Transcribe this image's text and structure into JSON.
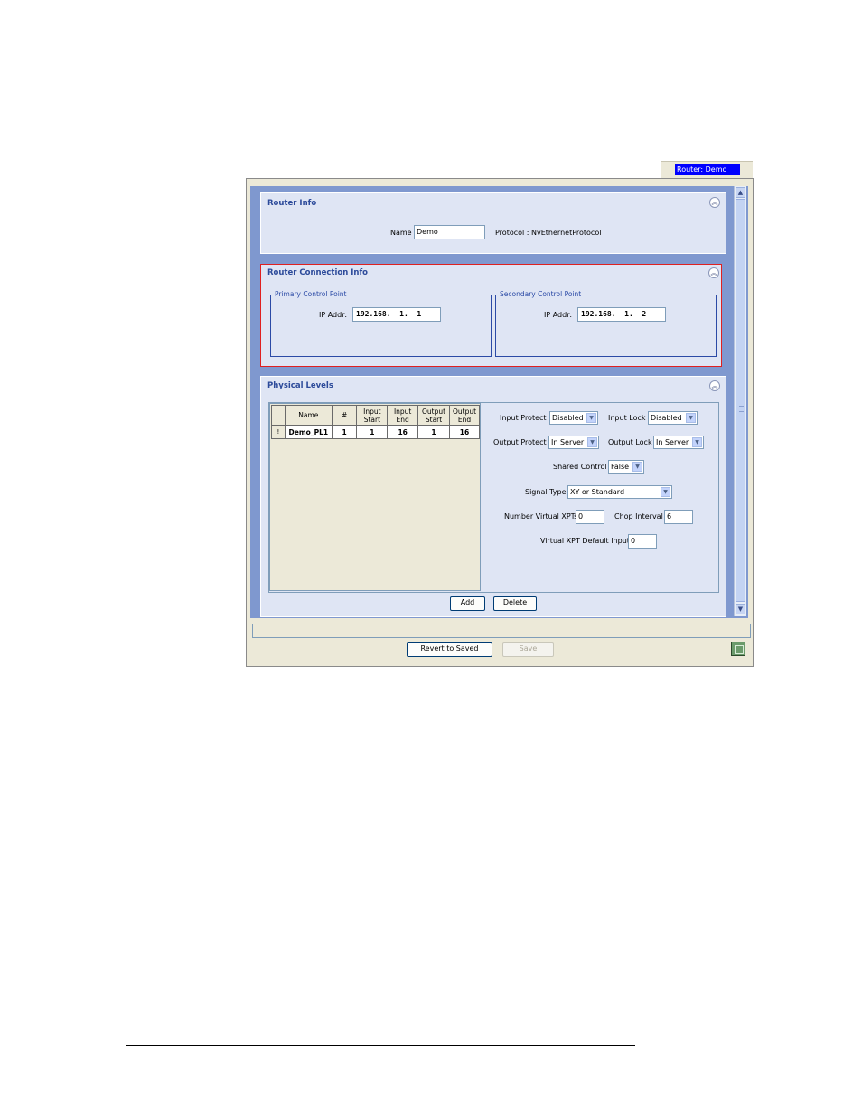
{
  "router_tag": "Router: Demo",
  "router_info": {
    "title": "Router Info",
    "name_label": "Name",
    "name_value": "Demo",
    "protocol_text": "Protocol : NvEthernetProtocol"
  },
  "connection_info": {
    "title": "Router Connection Info",
    "primary": {
      "legend": "Primary Control Point",
      "ip_label": "IP Addr:",
      "ip_value": "192.168.  1.  1"
    },
    "secondary": {
      "legend": "Secondary Control Point",
      "ip_label": "IP Addr:",
      "ip_value": "192.168.  1.  2"
    }
  },
  "physical_levels": {
    "title": "Physical Levels",
    "columns": {
      "name": "Name",
      "num": "#",
      "input_start": [
        "Input",
        "Start"
      ],
      "input_end": [
        "Input",
        "End"
      ],
      "output_start": [
        "Output",
        "Start"
      ],
      "output_end": [
        "Output",
        "End"
      ]
    },
    "rows": [
      {
        "marker": "!",
        "name": "Demo_PL1",
        "num": "1",
        "input_start": "1",
        "input_end": "16",
        "output_start": "1",
        "output_end": "16"
      }
    ],
    "input_protect": {
      "label": "Input Protect",
      "value": "Disabled"
    },
    "input_lock": {
      "label": "Input Lock",
      "value": "Disabled"
    },
    "output_protect": {
      "label": "Output Protect",
      "value": "In Server"
    },
    "output_lock": {
      "label": "Output Lock",
      "value": "In Server"
    },
    "shared_control": {
      "label": "Shared Control",
      "value": "False"
    },
    "signal_type": {
      "label": "Signal Type",
      "value": "XY or Standard"
    },
    "number_virtual_xpts": {
      "label": "Number Virtual XPTs",
      "value": "0"
    },
    "chop_interval": {
      "label": "Chop Interval",
      "value": "6"
    },
    "virtual_xpt_default_input": {
      "label": "Virtual XPT Default Input",
      "value": "0"
    },
    "add_label": "Add",
    "delete_label": "Delete"
  },
  "footer": {
    "revert_label": "Revert to Saved",
    "save_label": "Save"
  },
  "icons": {
    "collapse": "chevron-double-up-icon",
    "dropdown": "chevron-down-icon",
    "scroll_up": "arrow-up-icon",
    "scroll_down": "arrow-down-icon",
    "status": "status-grid-icon"
  },
  "colors": {
    "scroll_area_bg": "#7f98cf",
    "panel_bg": "#dfe5f4",
    "title_text": "#2c4a9a",
    "highlight_border": "#e02020",
    "router_tag_bg": "#0000ff"
  }
}
